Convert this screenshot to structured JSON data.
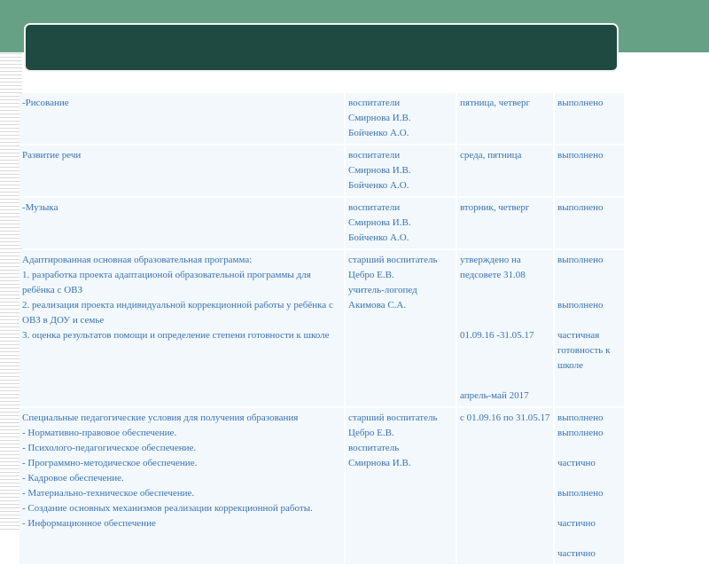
{
  "header": {
    "title": ""
  },
  "rows": [
    {
      "activity": "-Рисование",
      "responsible": "воспитатели\nСмирнова И.В.\nБойченко А.О.",
      "timing": "пятница, четверг",
      "status": "выполнено"
    },
    {
      "activity": "Развитие речи",
      "responsible": "воспитатели\nСмирнова И.В.\nБойченко А.О.",
      "timing": "среда, пятница",
      "status": "выполнено"
    },
    {
      "activity": "-Музыка",
      "responsible": "воспитатели\nСмирнова И.В.\nБойченко А.О.",
      "timing": "вторник, четверг",
      "status": "выполнено"
    },
    {
      "activity": "Адаптированная основная образовательная программа:\n1. разработка проекта адаптационой образовательной программы для ребёнка с ОВЗ\n2. реализация проекта индивидуальной коррекционной работы у ребёнка с ОВЗ в ДОУ и семье\n3. оценка результатов помощи  и определение степени готовности к школе",
      "responsible": "старший воспитатель\nЦебро Е.В.\nучитель-логопед\nАкимова С.А.",
      "timing": "утверждено на педсовете 31.08\n\n\n\n01.09.16 -31.05.17\n\n\n\nапрель-май 2017",
      "status": " выполнено\n\n\nвыполнено\n\nчастичная готовность к школе"
    },
    {
      "activity": "Специальные педагогические условия для получения образования\n- Нормативно-правовое обеспечение.\n- Психолого-педагогическое обеспечение.\n- Программно-методическое обеспечение.\n- Кадровое обеспечение.\n- Материально-техническое обеспечение.\n- Создание основных механизмов реализации коррекционной работы.\n- Информационное обеспечение",
      "responsible": "старший воспитатель\nЦебро Е.В.\nвоспитатель\nСмирнова И.В.",
      "timing": " с 01.09.16 по 31.05.17",
      "status": "выполнено\nвыполнено\n\nчастично\n\nвыполнено\n\nчастично\n\nчастично"
    }
  ]
}
